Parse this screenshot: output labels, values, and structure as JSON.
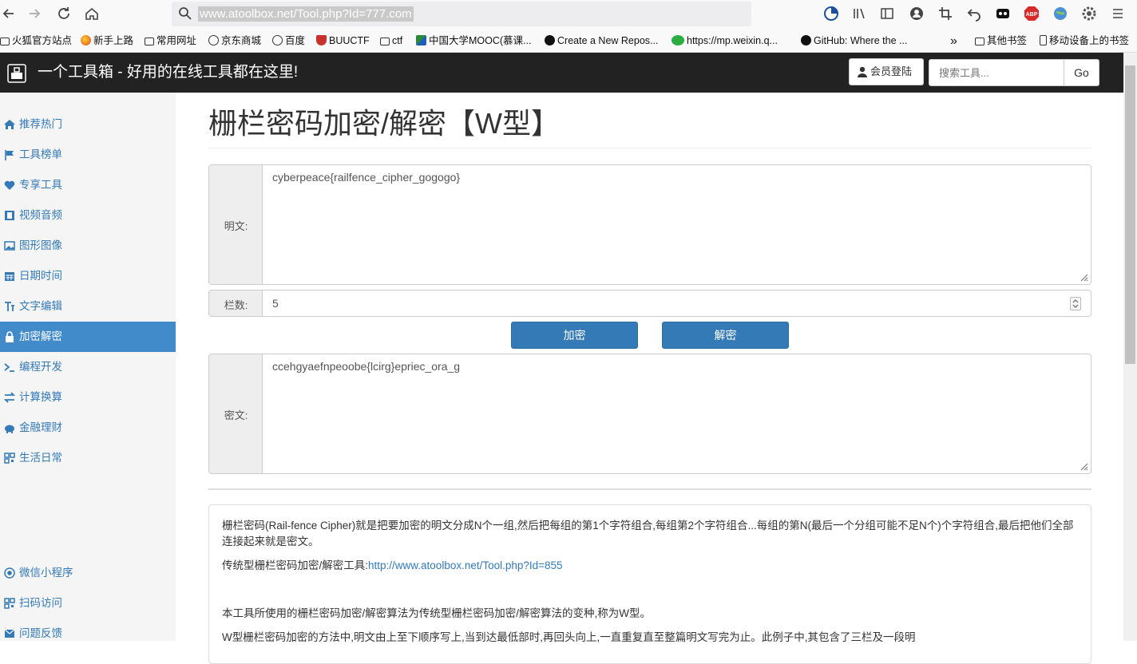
{
  "browser": {
    "url": "www.atoolbox.net/Tool.php?Id=777.com",
    "bookmarks": [
      {
        "label": "火狐官方站点",
        "icon": "folder-icon"
      },
      {
        "label": "新手上路",
        "icon": "firefox-icon"
      },
      {
        "label": "常用网址",
        "icon": "folder-icon"
      },
      {
        "label": "京东商城",
        "icon": "globe-icon"
      },
      {
        "label": "百度",
        "icon": "globe-icon"
      },
      {
        "label": "BUUCTF",
        "icon": "shield-icon"
      },
      {
        "label": "ctf",
        "icon": "folder-icon"
      },
      {
        "label": "中国大学MOOC(慕课...",
        "icon": "flag-icon"
      },
      {
        "label": "Create a New Repos...",
        "icon": "github-icon"
      },
      {
        "label": "https://mp.weixin.q...",
        "icon": "wechat-icon"
      },
      {
        "label": "GitHub: Where the ...",
        "icon": "github-icon"
      },
      {
        "label": "其他书签",
        "icon": "folder-icon"
      },
      {
        "label": "移动设备上的书签",
        "icon": "mobile-icon"
      }
    ]
  },
  "site": {
    "title": "一个工具箱 - 好用的在线工具都在这里!",
    "login_label": "会员登陆",
    "search_placeholder": "搜索工具...",
    "go_label": "Go"
  },
  "sidebar": {
    "items": [
      {
        "label": "推荐热门",
        "icon": "home-icon"
      },
      {
        "label": "工具榜单",
        "icon": "flag-icon"
      },
      {
        "label": "专享工具",
        "icon": "heart-icon"
      },
      {
        "label": "视频音频",
        "icon": "film-icon"
      },
      {
        "label": "图形图像",
        "icon": "picture-icon"
      },
      {
        "label": "日期时间",
        "icon": "calendar-icon"
      },
      {
        "label": "文字编辑",
        "icon": "text-icon"
      },
      {
        "label": "加密解密",
        "icon": "lock-icon"
      },
      {
        "label": "编程开发",
        "icon": "terminal-icon"
      },
      {
        "label": "计算换算",
        "icon": "transfer-icon"
      },
      {
        "label": "金融理财",
        "icon": "piggy-icon"
      },
      {
        "label": "生活日常",
        "icon": "qrcode-icon"
      }
    ],
    "bottom_items": [
      {
        "label": "微信小程序",
        "icon": "record-icon"
      },
      {
        "label": "扫码访问",
        "icon": "qrcode-icon"
      },
      {
        "label": "问题反馈",
        "icon": "envelope-icon"
      }
    ],
    "active_color": "#428bca"
  },
  "main": {
    "title": "栅栏密码加密/解密【W型】",
    "plaintext_label": "明文:",
    "plaintext_value": "cyberpeace{railfence_cipher_gogogo}",
    "rails_label": "栏数:",
    "rails_value": "5",
    "encrypt_label": "加密",
    "decrypt_label": "解密",
    "ciphertext_label": "密文:",
    "ciphertext_value": "ccehgyaefnpeoobe{lcirg}epriec_ora_g",
    "desc": {
      "p1": "栅栏密码(Rail-fence Cipher)就是把要加密的明文分成N个一组,然后把每组的第1个字符组合,每组第2个字符组合...每组的第N(最后一个分组可能不足N个)个字符组合,最后把他们全部连接起来就是密文。",
      "p2_prefix": "传统型栅栏密码加密/解密工具:",
      "p2_link": "http://www.atoolbox.net/Tool.php?Id=855",
      "p3": "本工具所使用的栅栏密码加密/解密算法为传统型栅栏密码加密/解密算法的变种,称为W型。",
      "p4": "W型栅栏密码加密的方法中,明文由上至下顺序写上,当到达最低部时,再回头向上,一直重复直至整篇明文写完为止。此例子中,其包含了三栏及一段明"
    }
  },
  "colors": {
    "navbar_bg": "#222222",
    "primary": "#337ab7",
    "link": "#337ab7"
  }
}
